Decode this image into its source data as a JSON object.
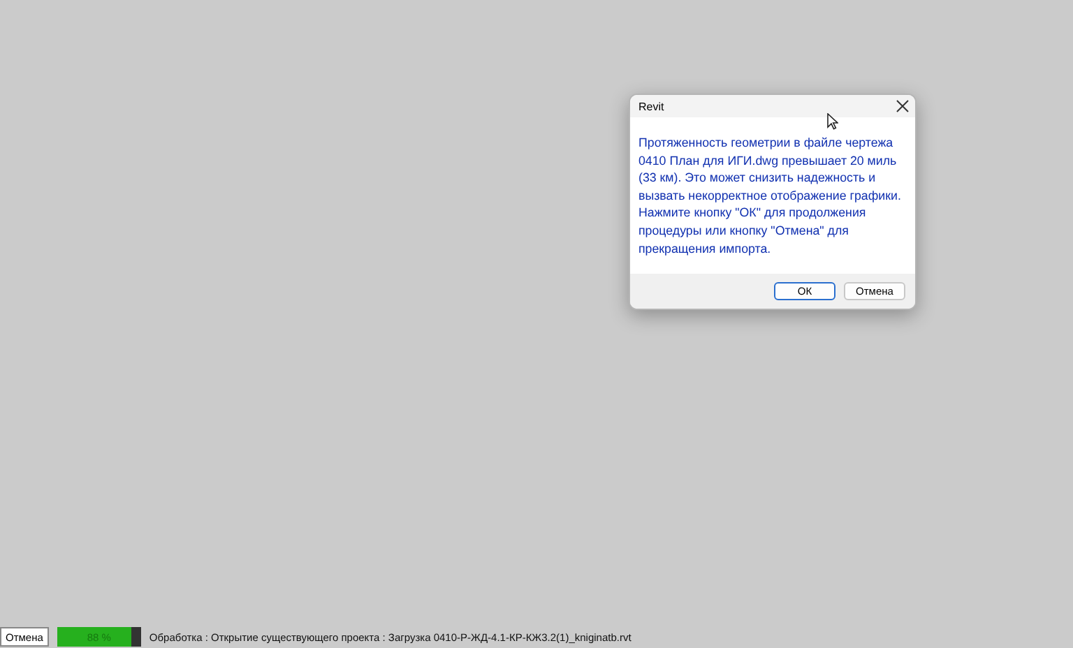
{
  "dialog": {
    "title": "Revit",
    "message": "Протяженность геометрии в файле чертежа 0410 План для ИГИ.dwg превышает 20 миль (33 км). Это может снизить надежность и вызвать некорректное отображение графики. Нажмите кнопку \"ОК\" для продолжения процедуры или кнопку \"Отмена\" для прекращения импорта.",
    "buttons": [
      {
        "label": "ОК",
        "default": true
      },
      {
        "label": "Отмена",
        "default": false
      }
    ]
  },
  "status_bar": {
    "cancel_button": "Отмена",
    "progress": {
      "level": 0.88,
      "reading": "88 %"
    },
    "status_text": "Обработка : Открытие существующего проекта : Загрузка 0410-Р-ЖД-4.1-КР-КЖ3.2(1)_kniginatb.rvt"
  }
}
